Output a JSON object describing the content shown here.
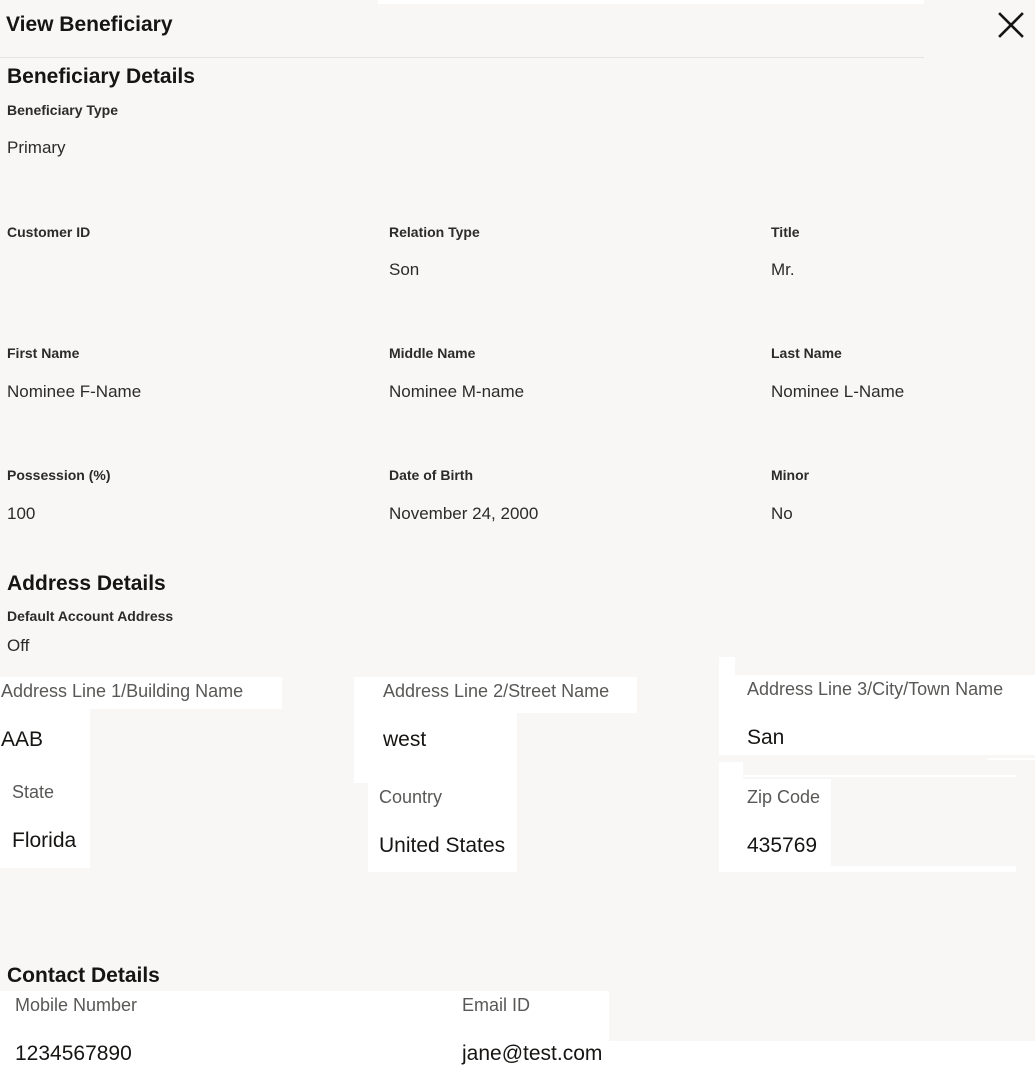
{
  "header": {
    "title": "View Beneficiary",
    "close_icon": "close-icon"
  },
  "beneficiary_details": {
    "title": "Beneficiary Details",
    "beneficiary_type": {
      "label": "Beneficiary Type",
      "value": "Primary"
    },
    "customer_id": {
      "label": "Customer ID",
      "value": ""
    },
    "relation_type": {
      "label": "Relation Type",
      "value": "Son"
    },
    "title_field": {
      "label": "Title",
      "value": "Mr."
    },
    "first_name": {
      "label": "First Name",
      "value": "Nominee F-Name"
    },
    "middle_name": {
      "label": "Middle Name",
      "value": "Nominee M-name"
    },
    "last_name": {
      "label": "Last Name",
      "value": "Nominee L-Name"
    },
    "possession": {
      "label": "Possession (%)",
      "value": "100"
    },
    "date_of_birth": {
      "label": "Date of Birth",
      "value": "November 24, 2000"
    },
    "minor": {
      "label": "Minor",
      "value": "No"
    }
  },
  "address_details": {
    "title": "Address Details",
    "default_account_address": {
      "label": "Default Account Address",
      "value": "Off"
    },
    "line1": {
      "label": "Address Line 1/Building Name",
      "value": "AAB"
    },
    "line2": {
      "label": "Address Line 2/Street Name",
      "value": "west"
    },
    "line3": {
      "label": "Address Line 3/City/Town Name",
      "value": "San"
    },
    "state": {
      "label": "State",
      "value": "Florida"
    },
    "country": {
      "label": "Country",
      "value": "United States"
    },
    "zip": {
      "label": "Zip Code",
      "value": "435769"
    }
  },
  "contact_details": {
    "title": "Contact Details",
    "mobile": {
      "label": "Mobile Number",
      "value": "1234567890"
    },
    "email": {
      "label": "Email ID",
      "value": "jane@test.com"
    }
  }
}
